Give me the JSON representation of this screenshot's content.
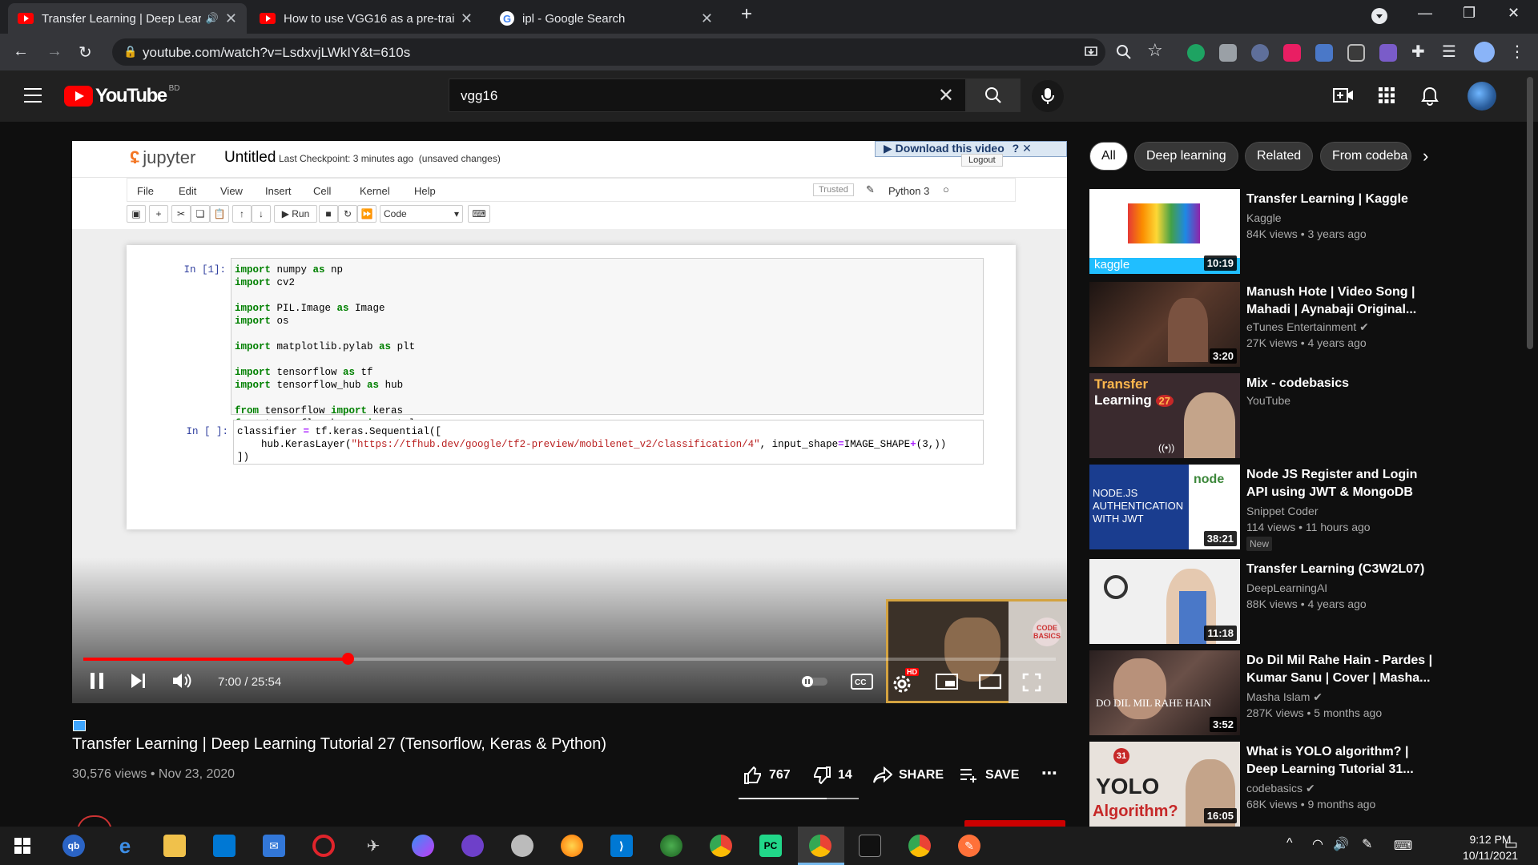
{
  "browser": {
    "tabs": [
      {
        "title": "Transfer Learning | Deep Lear",
        "active": true,
        "audio": true
      },
      {
        "title": "How to use VGG16 as a pre-train",
        "active": false
      },
      {
        "title": "ipl - Google Search",
        "active": false
      }
    ],
    "url": "youtube.com/watch?v=LsdxvjLWkIY&t=610s"
  },
  "youtube": {
    "logo": "YouTube",
    "country": "BD",
    "search_value": "vgg16"
  },
  "player": {
    "notebook": {
      "brand": "jupyter",
      "name": "Untitled",
      "checkpoint": "Last Checkpoint: 3 minutes ago",
      "unsaved": "(unsaved changes)",
      "download_banner": "Download this video",
      "logout": "Logout",
      "menu": [
        "File",
        "Edit",
        "View",
        "Insert",
        "Cell",
        "Kernel",
        "Help"
      ],
      "trusted": "Trusted",
      "kernel": "Python 3",
      "run_label": "Run",
      "cell_type": "Code",
      "cell1_prompt": "In [1]:",
      "cell2_prompt": "In [ ]:"
    },
    "webcam_logo": "CODE BASICS",
    "time": "7:00 / 25:54",
    "progress_fraction": 0.2717,
    "hd": "HD"
  },
  "video": {
    "title": "Transfer Learning | Deep Learning Tutorial 27 (Tensorflow, Keras & Python)",
    "meta": "30,576 views • Nov 23, 2020",
    "likes": "767",
    "dislikes": "14",
    "share": "SHARE",
    "save": "SAVE"
  },
  "chips": [
    "All",
    "Deep learning",
    "Related",
    "From codeba"
  ],
  "recommendations": [
    {
      "title": "Transfer Learning | Kaggle",
      "channel": "Kaggle",
      "views": "84K views • 3 years ago",
      "duration": "10:19",
      "thumb_color": "#1a1a1a"
    },
    {
      "title": "Manush Hote | Video Song | Mahadi | Aynabaji Original...",
      "channel": "eTunes Entertainment",
      "views": "27K views • 4 years ago",
      "duration": "3:20",
      "thumb_color": "#3b2a22"
    },
    {
      "title": "Mix - codebasics",
      "channel": "YouTube",
      "views": "",
      "duration": "",
      "thumb_color": "#5a2d2d"
    },
    {
      "title": "Node JS Register and Login API using JWT & MongoDB",
      "channel": "Snippet Coder",
      "views": "114 views • 11 hours ago",
      "badge": "New",
      "duration": "38:21",
      "thumb_color": "#1e3a8a"
    },
    {
      "title": "Transfer Learning (C3W2L07)",
      "channel": "DeepLearningAI",
      "views": "88K views • 4 years ago",
      "duration": "11:18",
      "thumb_color": "#dcdcdc"
    },
    {
      "title": "Do Dil Mil Rahe Hain - Pardes | Kumar Sanu | Cover | Masha...",
      "channel": "Masha Islam",
      "views": "287K views • 5 months ago",
      "duration": "3:52",
      "thumb_color": "#4a3a34"
    },
    {
      "title": "What is YOLO algorithm? | Deep Learning Tutorial 31...",
      "channel": "codebasics",
      "views": "68K views • 9 months ago",
      "duration": "16:05",
      "thumb_color": "#ded7d0"
    }
  ],
  "thumb_text": {
    "kaggle": "kaggle",
    "mix_line1": "Transfer",
    "mix_line2": "Learning",
    "mix_num": "27",
    "node1": "NODE.JS",
    "node2": "AUTHENTICATION",
    "node3": "WITH JWT",
    "yolo_num": "31",
    "yolo": "YOLO",
    "yolo2": "Algorithm?",
    "song": "DO DIL MIL RAHE HAIN"
  },
  "taskbar": {
    "time": "9:12 PM",
    "date": "10/11/2021"
  }
}
